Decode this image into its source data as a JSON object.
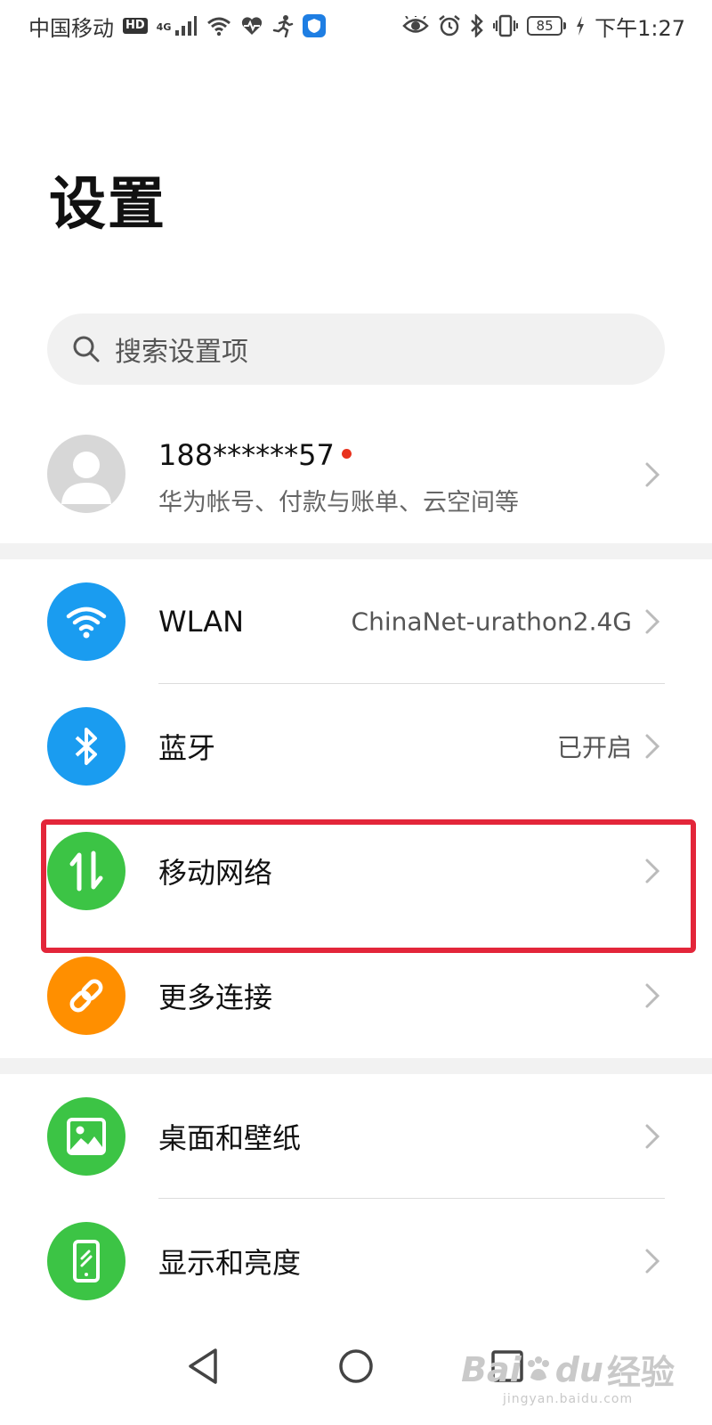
{
  "status_bar": {
    "carrier": "中国移动",
    "hd": "HD",
    "network": "4G",
    "battery": "85",
    "time": "下午1:27"
  },
  "page": {
    "title": "设置"
  },
  "search": {
    "placeholder": "搜索设置项"
  },
  "account": {
    "name": "188******57",
    "subtitle": "华为帐号、付款与账单、云空间等"
  },
  "items": [
    {
      "label": "WLAN",
      "value": "ChinaNet-urathon2.4G",
      "icon": "wifi-icon",
      "color": "#1a9cf0"
    },
    {
      "label": "蓝牙",
      "value": "已开启",
      "icon": "bluetooth-icon",
      "color": "#1a9cf0"
    },
    {
      "label": "移动网络",
      "value": "",
      "icon": "mobile-data-icon",
      "color": "#3cc445"
    },
    {
      "label": "更多连接",
      "value": "",
      "icon": "link-icon",
      "color": "#ff8f00"
    },
    {
      "label": "桌面和壁纸",
      "value": "",
      "icon": "image-icon",
      "color": "#3cc445"
    },
    {
      "label": "显示和亮度",
      "value": "",
      "icon": "phone-display-icon",
      "color": "#3cc445"
    }
  ],
  "highlight": {
    "color": "#e3263a"
  },
  "watermark": {
    "brand": "Bai",
    "brand2": "du",
    "cn": "经验",
    "url": "jingyan.baidu.com"
  }
}
